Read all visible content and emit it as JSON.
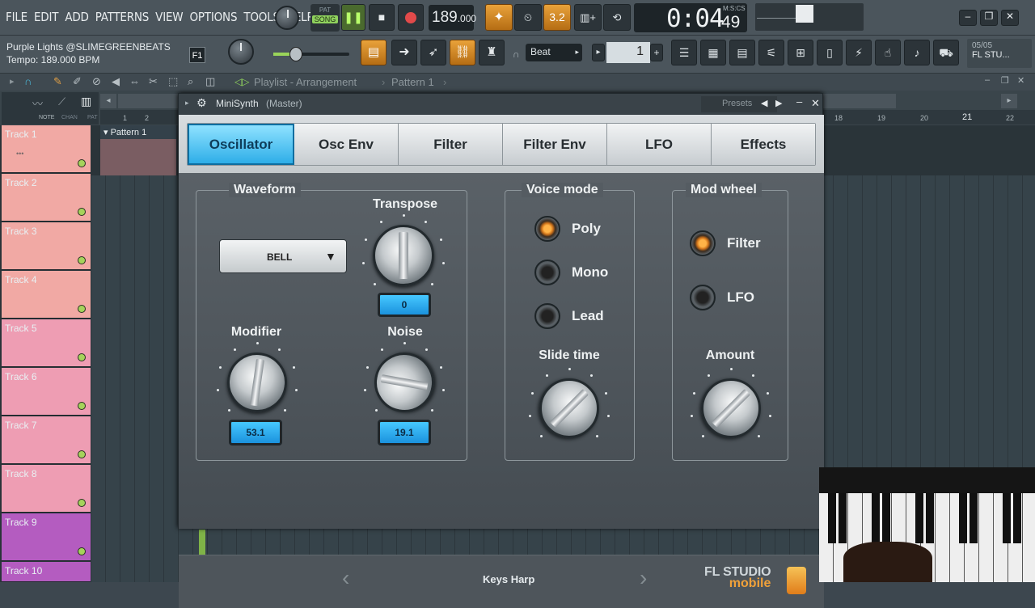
{
  "menu": [
    "FILE",
    "EDIT",
    "ADD",
    "PATTERNS",
    "VIEW",
    "OPTIONS",
    "TOOLS",
    "HELP"
  ],
  "transport": {
    "pat_label": "PAT",
    "song_label": "SONG",
    "tempo": "189",
    "tempo_frac": ".000",
    "time": "0:04",
    "time_cs": "49",
    "time_mode": "M:S:CS",
    "pattern_step": "3.2"
  },
  "project": {
    "title": "Purple Lights @SLIMEGREENBEATS",
    "tempo_text": "Tempo: 189.000 BPM",
    "hint_key": "F1"
  },
  "snap": {
    "label": "Beat"
  },
  "pattern_number": "1",
  "news": {
    "date": "05/05",
    "text": "FL STU..."
  },
  "playlist": {
    "title": "Playlist - Arrangement",
    "pattern": "Pattern 1",
    "pattern_block": "Pattern 1",
    "toolbar_labels": [
      "NOTE",
      "CHAN",
      "PAT"
    ],
    "ruler_left": [
      "1",
      "2"
    ],
    "ruler_right": [
      "18",
      "19",
      "20",
      "21",
      "22"
    ]
  },
  "tracks": [
    "Track 1",
    "Track 2",
    "Track 3",
    "Track 4",
    "Track 5",
    "Track 6",
    "Track 7",
    "Track 8",
    "Track 9",
    "Track 10"
  ],
  "track_colors": [
    "#f1a9a4",
    "#f1a9a4",
    "#f1a9a4",
    "#f1a9a4",
    "#ee9db3",
    "#ee9db3",
    "#ee9db3",
    "#ee9db3",
    "#b45cc0",
    "#b45cc0"
  ],
  "synth": {
    "title": "MiniSynth",
    "title_sub": "(Master)",
    "presets_label": "Presets",
    "tabs": [
      "Oscillator",
      "Osc Env",
      "Filter",
      "Filter Env",
      "LFO",
      "Effects"
    ],
    "active_tab": "Oscillator",
    "waveform": {
      "label": "Waveform",
      "value": "BELL"
    },
    "transpose": {
      "label": "Transpose",
      "value": "0"
    },
    "modifier": {
      "label": "Modifier",
      "value": "53.1"
    },
    "noise": {
      "label": "Noise",
      "value": "19.1"
    },
    "voice_mode": {
      "label": "Voice mode",
      "options": [
        "Poly",
        "Mono",
        "Lead"
      ],
      "selected": "Poly"
    },
    "slide_time": {
      "label": "Slide time"
    },
    "mod_wheel": {
      "label": "Mod wheel",
      "options": [
        "Filter",
        "LFO"
      ],
      "selected": "Filter"
    },
    "amount": {
      "label": "Amount"
    },
    "preset_name": "Keys Harp",
    "brand": "FL STUDIO",
    "brand_sub": "mobile"
  }
}
